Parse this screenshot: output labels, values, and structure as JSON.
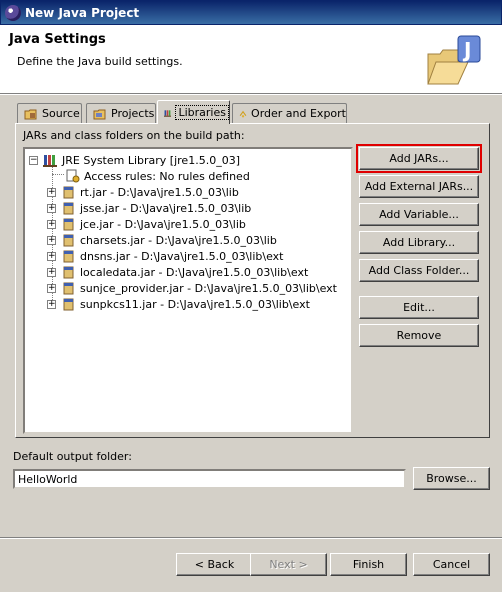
{
  "window": {
    "title": "New Java Project"
  },
  "header": {
    "title": "Java Settings",
    "description": "Define the Java build settings."
  },
  "tabs": [
    {
      "label": "Source"
    },
    {
      "label": "Projects"
    },
    {
      "label": "Libraries",
      "selected": true
    },
    {
      "label": "Order and Export"
    }
  ],
  "libraries": {
    "label": "JARs and class folders on the build path:",
    "tree": {
      "root": "JRE System Library [jre1.5.0_03]",
      "access_rules": "Access rules: No rules defined",
      "jars": [
        "rt.jar - D:\\Java\\jre1.5.0_03\\lib",
        "jsse.jar - D:\\Java\\jre1.5.0_03\\lib",
        "jce.jar - D:\\Java\\jre1.5.0_03\\lib",
        "charsets.jar - D:\\Java\\jre1.5.0_03\\lib",
        "dnsns.jar - D:\\Java\\jre1.5.0_03\\lib\\ext",
        "localedata.jar - D:\\Java\\jre1.5.0_03\\lib\\ext",
        "sunjce_provider.jar - D:\\Java\\jre1.5.0_03\\lib\\ext",
        "sunpkcs11.jar - D:\\Java\\jre1.5.0_03\\lib\\ext"
      ]
    },
    "buttons": {
      "add_jars": "Add JARs...",
      "add_external_jars": "Add External JARs...",
      "add_variable": "Add Variable...",
      "add_library": "Add Library...",
      "add_class_folder": "Add Class Folder...",
      "edit": "Edit...",
      "remove": "Remove"
    }
  },
  "output": {
    "label": "Default output folder:",
    "value": "HelloWorld",
    "browse": "Browse..."
  },
  "footer": {
    "back": "< Back",
    "next": "Next >",
    "finish": "Finish",
    "cancel": "Cancel"
  },
  "colors": {
    "highlight": "#e00000",
    "titlebar": "#0a246a"
  }
}
